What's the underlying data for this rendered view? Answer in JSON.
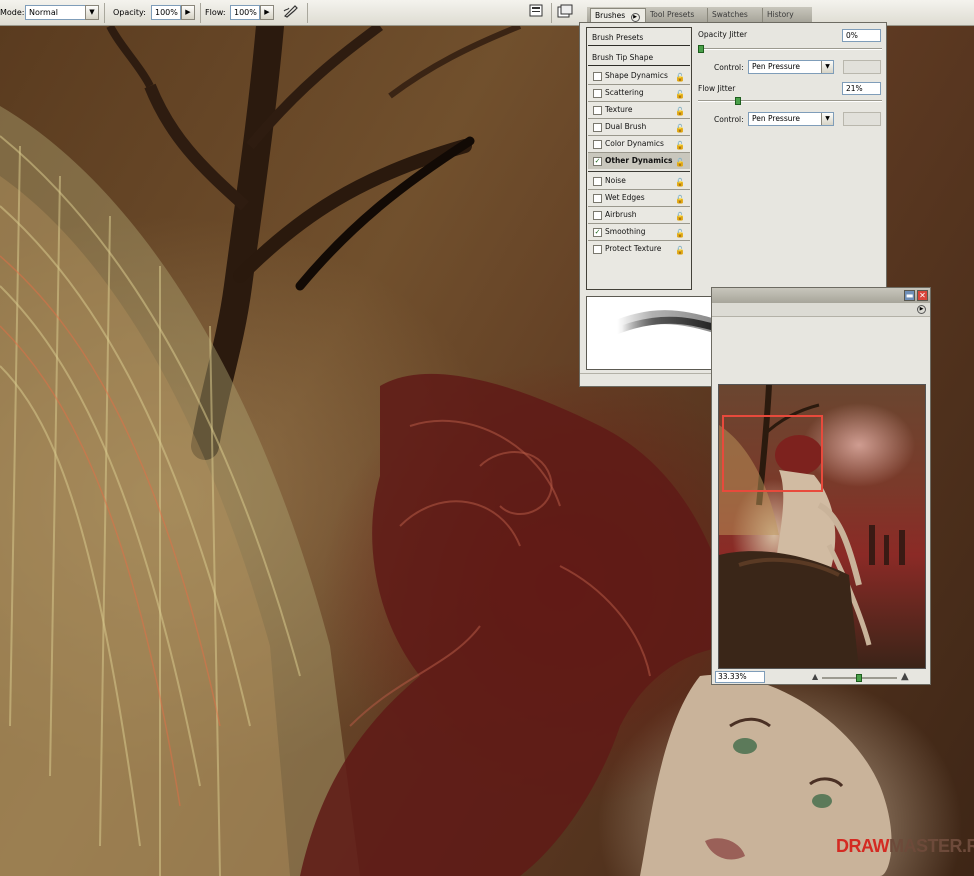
{
  "options_bar": {
    "mode_label": "Mode:",
    "mode_value": "Normal",
    "opacity_label": "Opacity:",
    "opacity_value": "100%",
    "flow_label": "Flow:",
    "flow_value": "100%"
  },
  "tabs": [
    {
      "label": "Brushes",
      "active": true
    },
    {
      "label": "Tool Presets",
      "active": false
    },
    {
      "label": "Swatches",
      "active": false
    },
    {
      "label": "History",
      "active": false
    }
  ],
  "brushes": {
    "presets_label": "Brush Presets",
    "tip_shape_label": "Brush Tip Shape",
    "options_group1": [
      {
        "label": "Shape Dynamics",
        "checked": false
      },
      {
        "label": "Scattering",
        "checked": false
      },
      {
        "label": "Texture",
        "checked": false
      },
      {
        "label": "Dual Brush",
        "checked": false
      },
      {
        "label": "Color Dynamics",
        "checked": false
      },
      {
        "label": "Other Dynamics",
        "checked": true,
        "selected": true
      }
    ],
    "options_group2": [
      {
        "label": "Noise",
        "checked": false
      },
      {
        "label": "Wet Edges",
        "checked": false
      },
      {
        "label": "Airbrush",
        "checked": false
      },
      {
        "label": "Smoothing",
        "checked": true
      },
      {
        "label": "Protect Texture",
        "checked": false
      }
    ],
    "opacity_jitter_label": "Opacity Jitter",
    "opacity_jitter_value": "0%",
    "opacity_jitter_level": 0,
    "opacity_control_label": "Control:",
    "opacity_control_value": "Pen Pressure",
    "flow_jitter_label": "Flow Jitter",
    "flow_jitter_value": "21%",
    "flow_jitter_level": 21,
    "flow_control_label": "Control:",
    "flow_control_value": "Pen Pressure"
  },
  "navigator": {
    "zoom_value": "33.33%"
  },
  "watermark": {
    "part1": "DRAW",
    "part2": "MASTER.RU"
  },
  "colors": {
    "selection_highlight": "#c9c7bd",
    "check_green": "#1e6a1e",
    "nav_view_box": "#e84a3c",
    "close_button": "#d9443a",
    "watermark_red": "#d42a22"
  }
}
